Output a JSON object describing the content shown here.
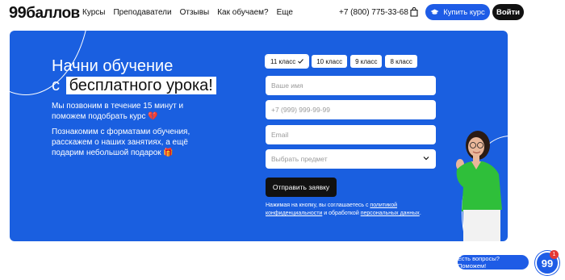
{
  "header": {
    "logo_num": "99",
    "logo_text": "баллов",
    "nav": [
      "Курсы",
      "Преподаватели",
      "Отзывы",
      "Как обучаем?",
      "Еще"
    ],
    "phone": "+7 (800) 775-33-68",
    "buy_label": "Купить курс",
    "login_label": "Войти"
  },
  "hero": {
    "title_line1": "Начни обучение",
    "title_prefix": "с",
    "title_highlight": "бесплатного урока!",
    "subtitle1": "Мы позвоним в течение 15 минут и поможем подобрать курс 💔",
    "subtitle2": "Познакомим с форматами обучения, расскажем о наших занятиях, а ещё подарим небольшой подарок 🎁"
  },
  "form": {
    "grades": [
      {
        "label": "11 класс",
        "selected": true
      },
      {
        "label": "10 класс",
        "selected": false
      },
      {
        "label": "9 класс",
        "selected": false
      },
      {
        "label": "8 класс",
        "selected": false
      }
    ],
    "name_placeholder": "Ваше имя",
    "phone_placeholder": "+7 (999) 999-99-99",
    "email_placeholder": "Email",
    "subject_placeholder": "Выбрать предмет",
    "submit_label": "Отправить заявку",
    "consent_prefix": "Нажимая на кнопку, вы соглашаетесь с ",
    "consent_link1": "политикой конфиденциальности",
    "consent_middle": " и обработкой ",
    "consent_link2": "персональных данных",
    "consent_suffix": "."
  },
  "chat": {
    "bubble_label": "Есть вопросы? Поможем!",
    "logo": "99",
    "badge": "1"
  },
  "colors": {
    "accent": "#1e5ce6",
    "hero_bg": "#1a5fe0",
    "dark": "#111111"
  }
}
